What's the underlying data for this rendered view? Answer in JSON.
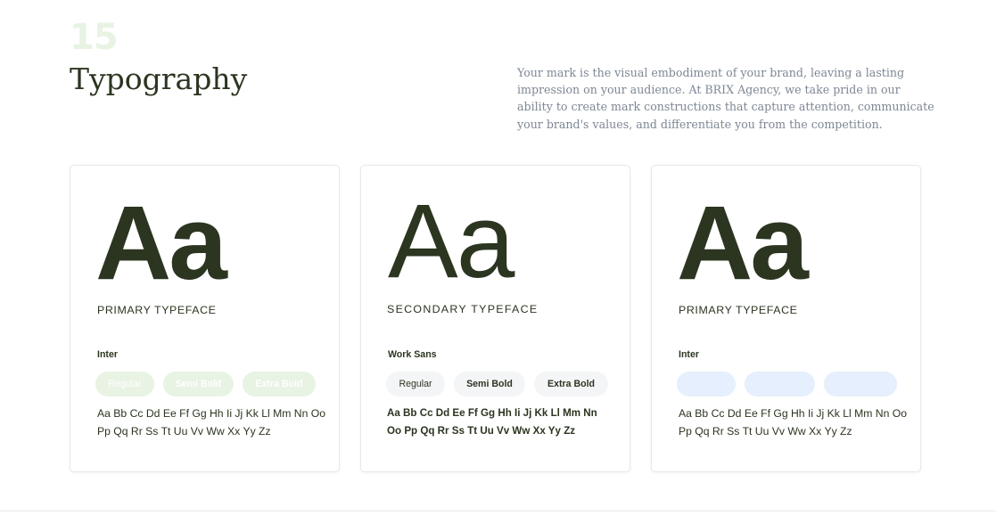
{
  "header": {
    "page_number": "15",
    "title": "Typography",
    "description": "Your mark is the visual embodiment of your brand, leaving a lasting impression on your audience. At BRIX Agency, we take pride in our ability to create mark constructions that capture attention, communicate your brand's values, and differentiate you from the competition."
  },
  "cards": [
    {
      "specimen": "Aa",
      "label": "PRIMARY TYPEFACE",
      "font_name": "Inter",
      "weights": [
        "Regular",
        "Semi Bold",
        "Extra Bold"
      ],
      "alphabet": "Aa Bb Cc Dd Ee Ff Gg Hh Ii Jj Kk Ll Mm Nn Oo Pp Qq Rr Ss Tt Uu Vv Ww Xx Yy Zz"
    },
    {
      "specimen": "Aa",
      "label": "SECONDARY TYPEFACE",
      "font_name": "Work Sans",
      "weights": [
        "Regular",
        "Semi Bold",
        "Extra Bold"
      ],
      "alphabet": "Aa Bb Cc Dd Ee Ff Gg Hh Ii Jj Kk Ll Mm Nn Oo Pp Qq Rr Ss Tt Uu Vv Ww Xx Yy Zz"
    },
    {
      "specimen": "Aa",
      "label": "PRIMARY TYPEFACE",
      "font_name": "Inter",
      "weights": [
        "",
        "",
        ""
      ],
      "alphabet": "Aa Bb Cc Dd Ee Ff Gg Hh Ii Jj Kk Ll Mm Nn Oo Pp Qq Rr Ss Tt Uu Vv Ww Xx Yy Zz"
    }
  ],
  "colors": {
    "text_dark": "#2b3520",
    "text_muted": "#7d8794",
    "accent_green": "#e8f3e4",
    "accent_blue": "#e5effd",
    "pill_grey": "#f4f5f7"
  }
}
